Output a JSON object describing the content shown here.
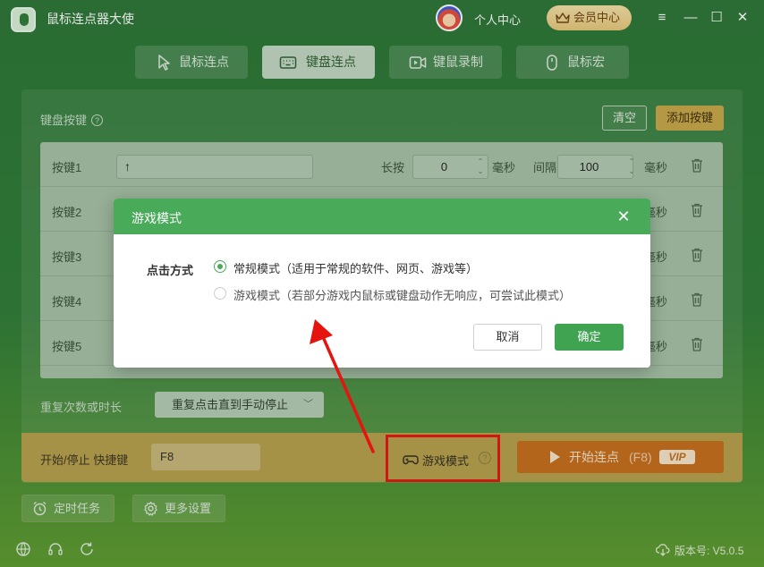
{
  "app": {
    "title": "鼠标连点器大使",
    "personal_center": "个人中心",
    "vip_center": "会员中心"
  },
  "tabs": [
    {
      "label": "鼠标连点",
      "icon": "cursor-icon"
    },
    {
      "label": "键盘连点",
      "icon": "keyboard-icon"
    },
    {
      "label": "键鼠录制",
      "icon": "video-record-icon"
    },
    {
      "label": "鼠标宏",
      "icon": "mouse-icon"
    }
  ],
  "keyboard_section": {
    "label": "键盘按键",
    "help": "?",
    "clear": "清空",
    "add": "添加按键"
  },
  "rows": [
    {
      "key": "按键1",
      "value": "↑",
      "hold_label": "长按",
      "hold": "0",
      "hold_unit": "毫秒",
      "interval_label": "间隔",
      "interval": "100",
      "interval_unit": "毫秒"
    },
    {
      "key": "按键2",
      "interval_unit": "毫秒"
    },
    {
      "key": "按键3",
      "interval_unit": "毫秒"
    },
    {
      "key": "按键4",
      "interval_unit": "毫秒"
    },
    {
      "key": "按键5",
      "interval_unit": "毫秒"
    }
  ],
  "repeat": {
    "label": "重复次数或时长",
    "value": "重复点击直到手动停止"
  },
  "controls": {
    "hotkey_label": "开始/停止 快捷键",
    "hotkey_value": "F8",
    "game_mode": "游戏模式",
    "start_label": "开始连点",
    "start_hotkey": "(F8)",
    "vip_badge": "VIP"
  },
  "bottom": {
    "timer_task": "定时任务",
    "more_settings": "更多设置",
    "version": "版本号: V5.0.5"
  },
  "dialog": {
    "title": "游戏模式",
    "click_method_label": "点击方式",
    "options": [
      {
        "label": "常规模式（适用于常规的软件、网页、游戏等）",
        "checked": true
      },
      {
        "label": "游戏模式（若部分游戏内鼠标或键盘动作无响应，可尝试此模式）",
        "checked": false
      }
    ],
    "cancel": "取消",
    "ok": "确定"
  },
  "colors": {
    "accent_green": "#49ab5a",
    "annotation_red": "#e6140f",
    "start_orange": "#c76b1a"
  }
}
